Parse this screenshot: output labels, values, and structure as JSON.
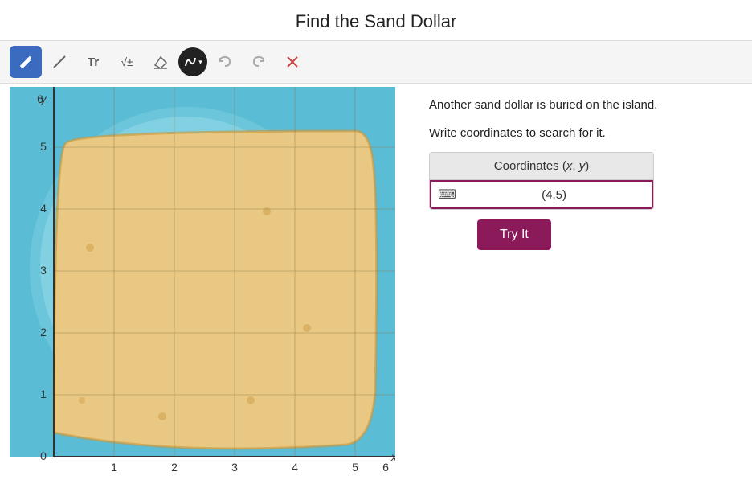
{
  "page": {
    "title": "Find the Sand Dollar"
  },
  "toolbar": {
    "tools": [
      {
        "id": "pen",
        "label": "✏",
        "active": true,
        "symbol": "✏"
      },
      {
        "id": "line",
        "label": "/",
        "active": false,
        "symbol": "/"
      },
      {
        "id": "text",
        "label": "Tt",
        "active": false,
        "symbol": "Tt"
      },
      {
        "id": "sqrt",
        "label": "√±",
        "active": false,
        "symbol": "√±"
      },
      {
        "id": "eraser",
        "label": "◇",
        "active": false,
        "symbol": "◇"
      },
      {
        "id": "curve",
        "label": "curve",
        "active": false,
        "isCircle": true
      }
    ],
    "description": "Another sand dollar is buried on the island."
  },
  "right_panel": {
    "description1": "Another sand dollar is buried on the island.",
    "description2": "Write coordinates to search for it.",
    "coordinates_header": "Coordinates (x, y)",
    "input_value": "(4,5)",
    "try_it_label": "Try It"
  },
  "graph": {
    "x_label": "x",
    "y_label": "y",
    "x_max": 6,
    "y_max": 6,
    "tick_labels_x": [
      "0",
      "1",
      "2",
      "3",
      "4",
      "5",
      "6"
    ],
    "tick_labels_y": [
      "0",
      "1",
      "2",
      "3",
      "4",
      "5",
      "6"
    ]
  },
  "colors": {
    "active_tool": "#3a6bbf",
    "ocean_deep": "#5bbcd6",
    "ocean_mid": "#7dd0e0",
    "ocean_light": "#a8dce8",
    "sand": "#e8c882",
    "sand_dark": "#d4a85a",
    "try_it": "#8b1a5a",
    "coordinates_border": "#8b1a5a"
  }
}
